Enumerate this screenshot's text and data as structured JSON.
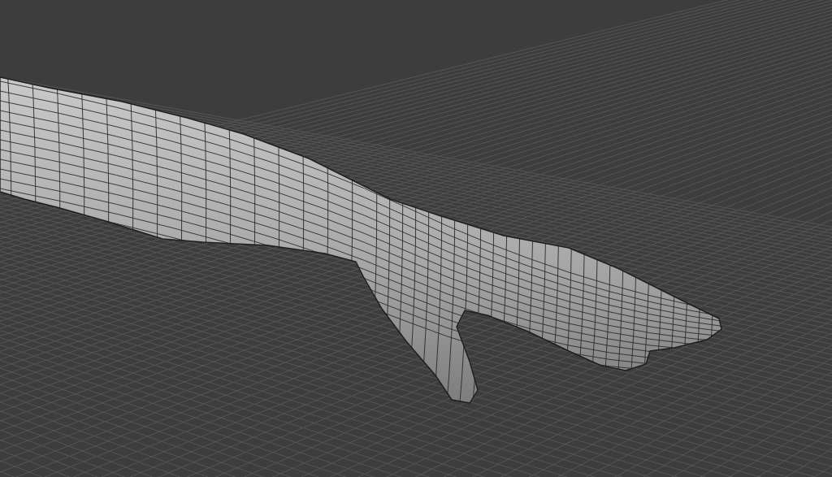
{
  "viewport": {
    "show_grid": true,
    "show_wireframe": true
  }
}
